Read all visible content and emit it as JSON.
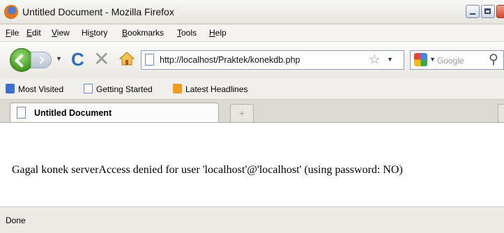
{
  "window": {
    "title": "Untitled Document - Mozilla Firefox"
  },
  "menu": [
    "File",
    "Edit",
    "View",
    "History",
    "Bookmarks",
    "Tools",
    "Help"
  ],
  "menu_mnemonic": [
    "F",
    "E",
    "V",
    "s",
    "B",
    "T",
    "H"
  ],
  "navigation": {
    "url": "http://localhost/Praktek/konekdb.php",
    "search_placeholder": "Google"
  },
  "bookmarks": [
    "Most Visited",
    "Getting Started",
    "Latest Headlines"
  ],
  "tabs": [
    {
      "label": "Untitled Document",
      "active": true
    }
  ],
  "new_tab_label": "+",
  "content": {
    "text": "Gagal konek serverAccess denied for user 'localhost'@'localhost' (using password: NO)"
  },
  "status": {
    "text": "Done"
  }
}
